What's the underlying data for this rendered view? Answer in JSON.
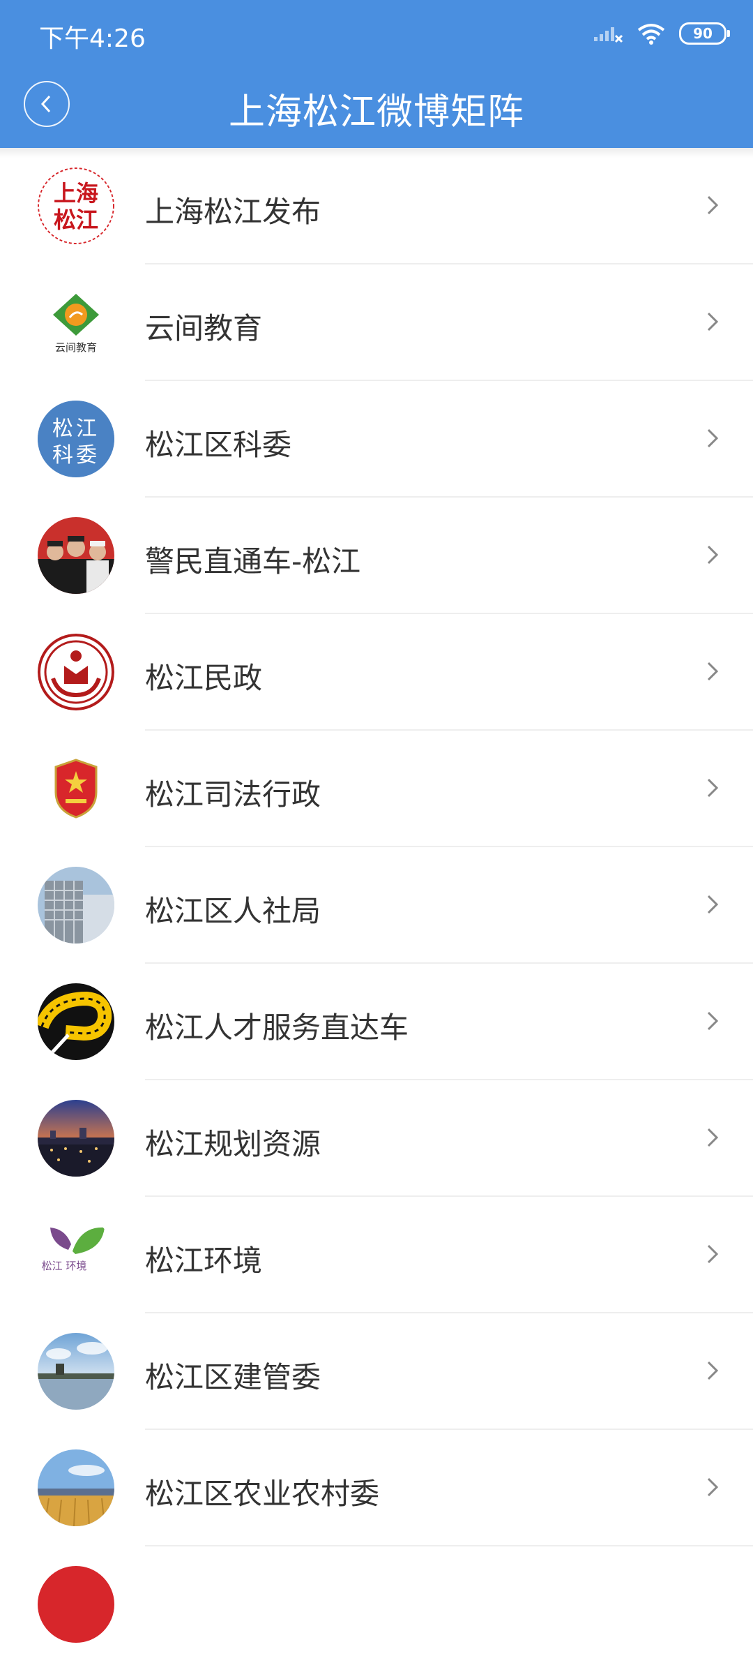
{
  "status_bar": {
    "time": "下午4:26",
    "battery": "90"
  },
  "header": {
    "title": "上海松江微博矩阵"
  },
  "accounts": [
    {
      "name": "上海松江发布",
      "icon": "songjiang-release-logo-icon"
    },
    {
      "name": "云间教育",
      "icon": "yunjian-education-logo-icon",
      "logo_text": "云间教育"
    },
    {
      "name": "松江区科委",
      "icon": "science-committee-logo-icon",
      "logo_text": "松江 科委"
    },
    {
      "name": "警民直通车-松江",
      "icon": "police-photo-icon"
    },
    {
      "name": "松江民政",
      "icon": "civil-affairs-logo-icon"
    },
    {
      "name": "松江司法行政",
      "icon": "justice-emblem-icon"
    },
    {
      "name": "松江区人社局",
      "icon": "building-photo-icon"
    },
    {
      "name": "松江人才服务直达车",
      "icon": "talent-service-logo-icon"
    },
    {
      "name": "松江规划资源",
      "icon": "city-night-photo-icon"
    },
    {
      "name": "松江环境",
      "icon": "environment-leaf-logo-icon",
      "logo_text": "松江 环境"
    },
    {
      "name": "松江区建管委",
      "icon": "lake-pagoda-photo-icon"
    },
    {
      "name": "松江区农业农村委",
      "icon": "wheat-field-photo-icon"
    }
  ]
}
